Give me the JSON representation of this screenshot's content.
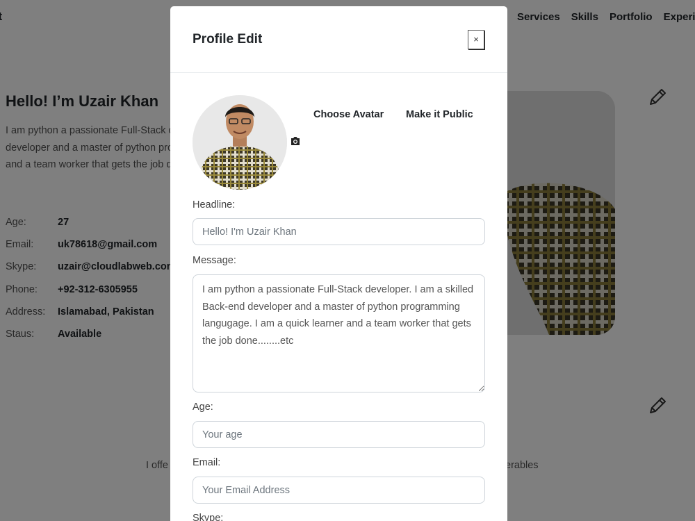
{
  "background": {
    "brand": "et",
    "nav": [
      "Services",
      "Skills",
      "Portfolio",
      "Experi"
    ],
    "hero": {
      "title": "Hello! I’m Uzair Khan",
      "text": "I am python a passionate Full-Stack developer. I am a skilled Back-end developer and a master of python programming langugage. I am a quick learner and a team worker that gets the job done."
    },
    "info": [
      {
        "label": "Age:",
        "value": "27"
      },
      {
        "label": "Email:",
        "value": "uk78618@gmail.com"
      },
      {
        "label": "Skype:",
        "value": "uzair@cloudlabweb.com"
      },
      {
        "label": "Phone:",
        "value": "+92-312-6305955"
      },
      {
        "label": "Address:",
        "value": "Islamabad, Pakistan"
      },
      {
        "label": "Staus:",
        "value": "Available"
      }
    ],
    "offer": {
      "left": "I offe",
      "right": "erables"
    }
  },
  "modal": {
    "title": "Profile Edit",
    "close_label": "×",
    "choose_avatar": "Choose Avatar",
    "make_public": "Make it Public",
    "headline": {
      "label": "Headline:",
      "placeholder": "Hello! I'm Uzair Khan"
    },
    "message": {
      "label": "Message:",
      "value": "I am python a passionate Full-Stack developer. I am a skilled Back-end developer and a master of python programming langugage. I am a quick learner and a team worker that gets the job done........etc"
    },
    "age": {
      "label": "Age:",
      "placeholder": "Your age"
    },
    "email": {
      "label": "Email:",
      "placeholder": "Your Email Address"
    },
    "skype": {
      "label": "Skype:"
    }
  },
  "icons": {
    "close": "close-icon",
    "camera": "camera-icon",
    "edit": "pencil-icon"
  },
  "colors": {
    "backdrop": "rgba(0,0,0,0.5)",
    "modal_bg": "#ffffff",
    "input_border": "#ced4da",
    "text": "#212529"
  }
}
